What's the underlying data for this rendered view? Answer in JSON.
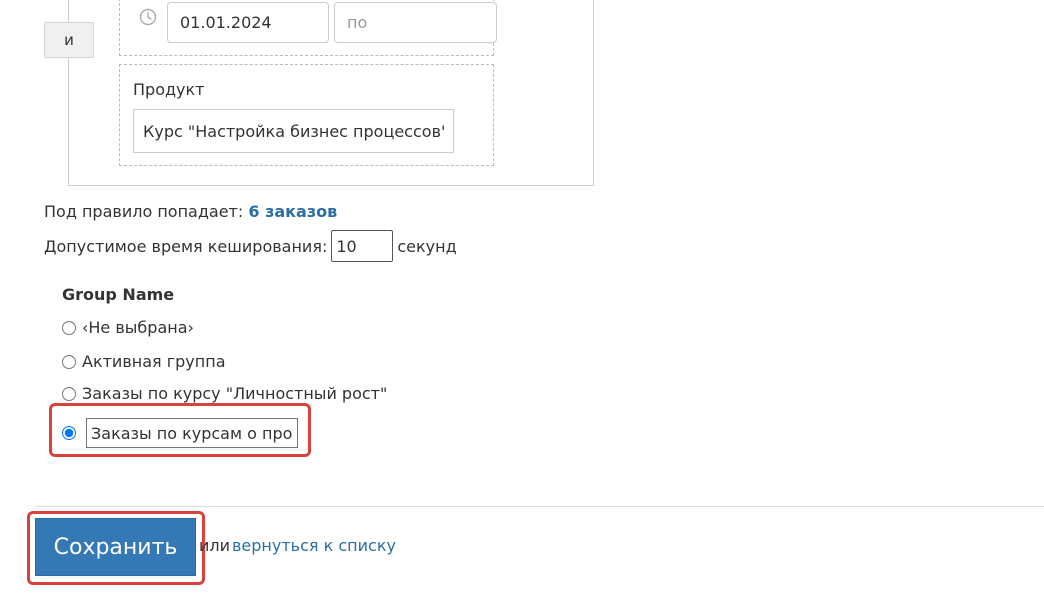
{
  "filter": {
    "and_label": "и",
    "date_from_value": "01.01.2024",
    "date_to_placeholder": "по",
    "product_label": "Продукт",
    "product_value": "Курс \"Настройка бизнес процессов\""
  },
  "stats": {
    "matches_prefix": "Под правило попадает:",
    "matches_link": "6 заказов",
    "cache_prefix": "Допустимое время кеширования:",
    "cache_value": "10",
    "cache_suffix": "секунд"
  },
  "group": {
    "title": "Group Name",
    "options": [
      {
        "label": "‹Не выбрана›",
        "checked": false
      },
      {
        "label": "Активная группа",
        "checked": false
      },
      {
        "label": "Заказы по курсу \"Личностный рост\"",
        "checked": false
      }
    ],
    "new_group_value": "Заказы по курсам о проц"
  },
  "actions": {
    "save_label": "Сохранить",
    "or_text": "или",
    "back_link": "вернуться к списку"
  },
  "colors": {
    "link": "#2a6ea6",
    "primary_button": "#3478b6",
    "highlight": "#d9423c"
  }
}
